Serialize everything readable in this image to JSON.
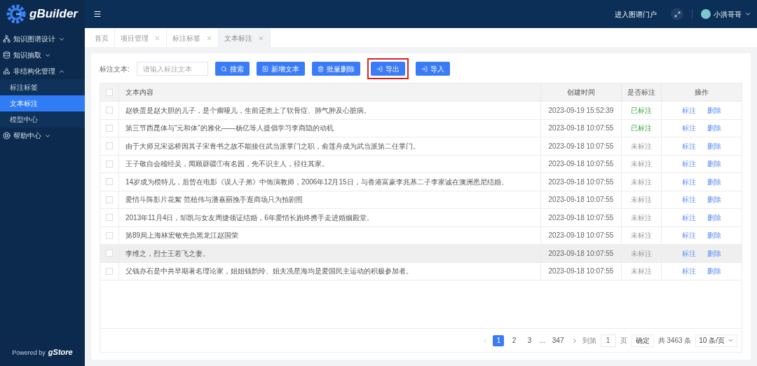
{
  "logo": {
    "text": "gBuilder"
  },
  "sidebar": {
    "items": [
      {
        "label": "知识图谱设计",
        "expanded": false
      },
      {
        "label": "知识抽取",
        "expanded": false
      },
      {
        "label": "非结构化管理",
        "expanded": true,
        "children": [
          {
            "label": "标注标签",
            "selected": false
          },
          {
            "label": "文本标注",
            "selected": true
          },
          {
            "label": "模型中心",
            "selected": false
          }
        ]
      },
      {
        "label": "帮助中心",
        "expanded": false
      }
    ],
    "powered_by": {
      "small": "Powered by",
      "brand": "gStore"
    }
  },
  "header": {
    "portal_link": "进入图谱门户",
    "user": "小洪哥哥"
  },
  "tabs": [
    {
      "label": "首页",
      "closable": false,
      "selected": false
    },
    {
      "label": "项目管理",
      "closable": true,
      "selected": false
    },
    {
      "label": "标注标签",
      "closable": true,
      "selected": false
    },
    {
      "label": "文本标注",
      "closable": true,
      "selected": true
    }
  ],
  "filter": {
    "label": "标注文本:",
    "placeholder": "请输入标注文本"
  },
  "buttons": [
    {
      "kind": "search",
      "label": "搜索",
      "highlighted": false
    },
    {
      "kind": "add",
      "label": "新增文本",
      "highlighted": false
    },
    {
      "kind": "delete",
      "label": "批量删除",
      "highlighted": false
    },
    {
      "kind": "export",
      "label": "导出",
      "highlighted": true
    },
    {
      "kind": "import",
      "label": "导入",
      "highlighted": false
    }
  ],
  "table": {
    "all_selected": false,
    "columns": [
      "文本内容",
      "创建时间",
      "是否标注",
      "操作"
    ],
    "rows": [
      {
        "text": "赵铁蛋是赵大胆的儿子，是个瘸哑儿，生前还患上了软骨症、肺气肿及心脏病。",
        "created": "2023-09-19 15:52:39",
        "status": "已标注",
        "annotated": true,
        "actions": [
          "标注",
          "删除"
        ],
        "checked": false,
        "highlighted": false
      },
      {
        "text": "第三节西昆体与“元和体”的雅化——杨亿等人提倡学习李商隐的动机",
        "created": "2023-09-18 10:07:55",
        "status": "已标注",
        "annotated": true,
        "actions": [
          "标注",
          "删除"
        ],
        "checked": false,
        "highlighted": false
      },
      {
        "text": "由于大师兄宋远桥因其子宋青书之故不能接任武当派掌门之职，俞莲舟成为武当派第二任掌门。",
        "created": "2023-09-18 10:07:55",
        "status": "未标注",
        "annotated": false,
        "actions": [
          "标注",
          "删除"
        ],
        "checked": false,
        "highlighted": false
      },
      {
        "text": "王子敬自会稽经吴，闻顾辟疆①有名园，先不识主人，径往其家。",
        "created": "2023-09-18 10:07:55",
        "status": "未标注",
        "annotated": false,
        "actions": [
          "标注",
          "删除"
        ],
        "checked": false,
        "highlighted": false
      },
      {
        "text": "14岁成为模特儿，后曾在电影《误人子弟》中饰演教师，2006年12月15日，与香港富豪李兆基二子李家诚在澳洲悉尼结婚。",
        "created": "2023-09-18 10:07:55",
        "status": "未标注",
        "annotated": false,
        "actions": [
          "标注",
          "删除"
        ],
        "checked": false,
        "highlighted": false
      },
      {
        "text": "爱情斗阵影片花絮 范植伟与潘嘉丽挽手逛商场只为拍剧照",
        "created": "2023-09-18 10:07:55",
        "status": "未标注",
        "annotated": false,
        "actions": [
          "标注",
          "删除"
        ],
        "checked": false,
        "highlighted": false
      },
      {
        "text": "2013年11月4日，邹凯与女友周捷领证结婚，6年爱情长跑终携手走进婚姻殿堂。",
        "created": "2023-09-18 10:07:55",
        "status": "未标注",
        "annotated": false,
        "actions": [
          "标注",
          "删除"
        ],
        "checked": false,
        "highlighted": false
      },
      {
        "text": "第89局上海林宏敏先负黑龙江赵国荣",
        "created": "2023-09-18 10:07:55",
        "status": "未标注",
        "annotated": false,
        "actions": [
          "标注",
          "删除"
        ],
        "checked": false,
        "highlighted": false
      },
      {
        "text": "李维之，烈士王若飞之妻。",
        "created": "2023-09-18 10:07:55",
        "status": "未标注",
        "annotated": false,
        "actions": [
          "标注",
          "删除"
        ],
        "checked": false,
        "highlighted": true
      },
      {
        "text": "父钱亦石是中共早期著名理论家，姐姐钱韵玲、姐夫冼星海均是爱国民主运动的积极参加者。",
        "created": "2023-09-18 10:07:55",
        "status": "未标注",
        "annotated": false,
        "actions": [
          "标注",
          "删除"
        ],
        "checked": false,
        "highlighted": false
      }
    ]
  },
  "pagination": {
    "pages": [
      {
        "label": "1",
        "selected": true
      },
      {
        "label": "2",
        "selected": false
      },
      {
        "label": "3",
        "selected": false
      }
    ],
    "ellipsis": "...",
    "last_page": "347",
    "goto_label": "到第",
    "goto_value": "1",
    "page_unit": "页",
    "confirm": "确定",
    "total": "共 3463 条",
    "page_size": "10 条/页"
  }
}
